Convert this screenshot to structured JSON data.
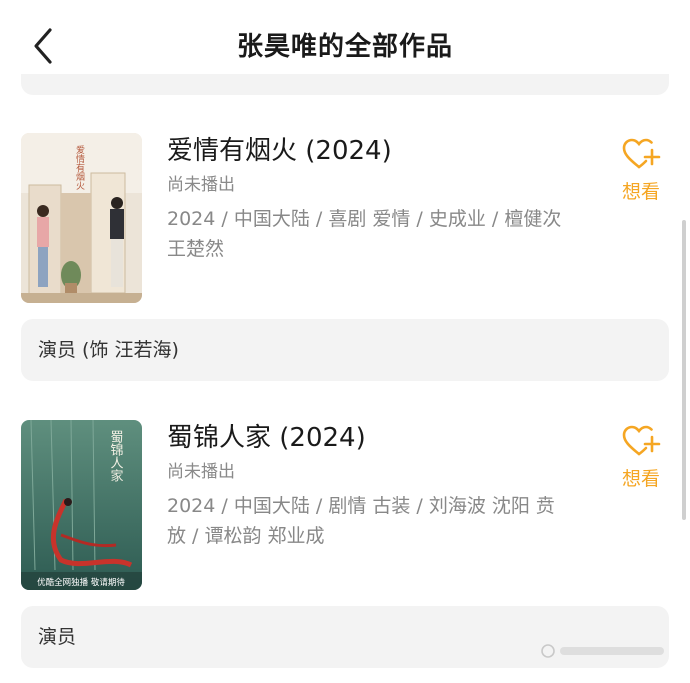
{
  "header": {
    "title": "张昊唯的全部作品"
  },
  "items": [
    {
      "title": "爱情有烟火 (2024)",
      "status": "尚未播出",
      "meta": "2024 / 中国大陆 / 喜剧 爱情 / 史成业 / 檀健次 王楚然",
      "want_label": "想看",
      "role": "演员 (饰 汪若海)",
      "poster_text": "爱情有烟火"
    },
    {
      "title": "蜀锦人家 (2024)",
      "status": "尚未播出",
      "meta": "2024 / 中国大陆 / 剧情 古装 / 刘海波 沈阳 贲放 / 谭松韵 郑业成",
      "want_label": "想看",
      "role": "演员",
      "poster_text": "蜀锦人家",
      "poster_caption": "优酷全网独播 敬请期待"
    }
  ]
}
